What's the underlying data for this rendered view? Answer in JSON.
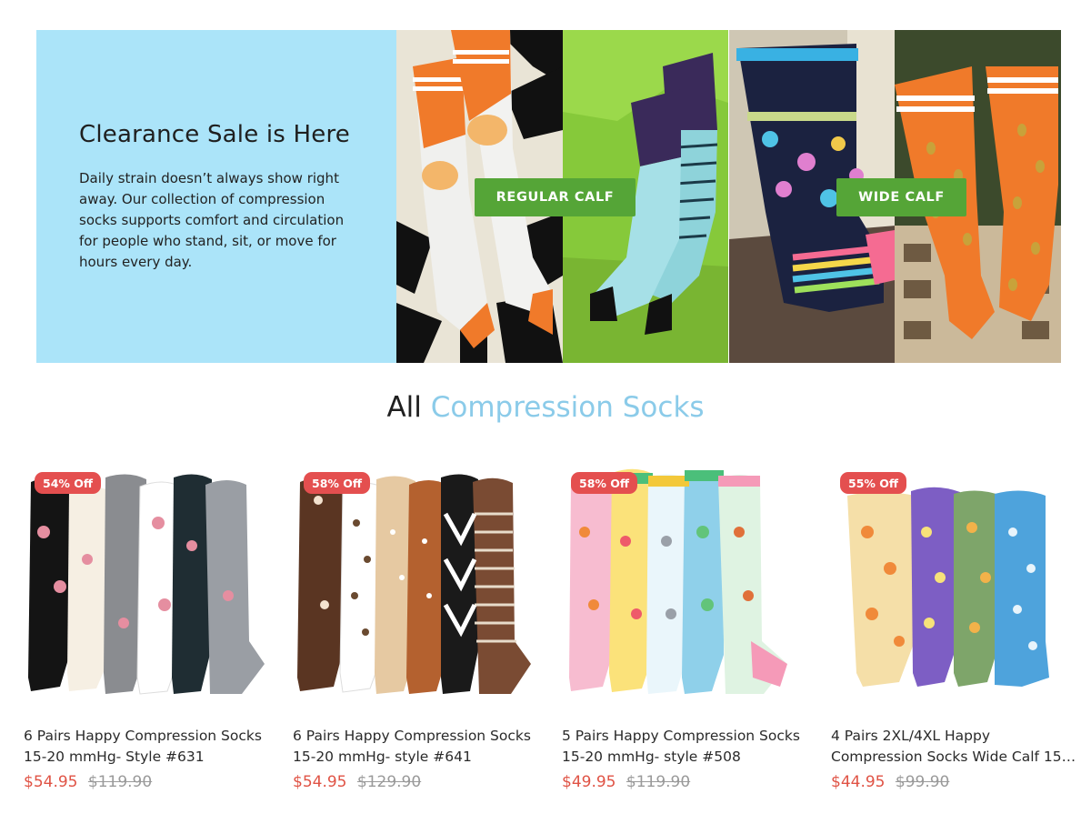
{
  "hero": {
    "title": "Clearance Sale is Here",
    "description": "Daily strain doesn’t always show right away. Our collection of compression socks supports comfort and circulation for people who stand, sit, or move for hours every day.",
    "buttons": {
      "regular": "REGULAR CALF",
      "wide": "WIDE CALF"
    },
    "colors": {
      "panel_bg": "#abe4f9",
      "button": "#55a537"
    }
  },
  "section": {
    "title_part1": "All",
    "title_part2": "Compression Socks",
    "colors": {
      "accent": "#8bcbe9"
    }
  },
  "products": [
    {
      "badge": "54% Off",
      "name_line1": "6 Pairs Happy Compression Socks",
      "name_line2": "15-20 mmHg- Style #631",
      "price": "$54.95",
      "old_price": "$119.90"
    },
    {
      "badge": "58% Off",
      "name_line1": "6 Pairs Happy Compression Socks",
      "name_line2": "15-20 mmHg- style #641",
      "price": "$54.95",
      "old_price": "$129.90"
    },
    {
      "badge": "58% Off",
      "name_line1": "5 Pairs Happy Compression Socks",
      "name_line2": "15-20 mmHg- style #508",
      "price": "$49.95",
      "old_price": "$119.90"
    },
    {
      "badge": "55% Off",
      "name_line1": "4 Pairs 2XL/4XL Happy",
      "name_line2": "Compression Socks Wide Calf 15-...",
      "price": "$44.95",
      "old_price": "$99.90"
    }
  ],
  "colors": {
    "sale_price": "#e05345",
    "badge": "#e44f4f"
  }
}
